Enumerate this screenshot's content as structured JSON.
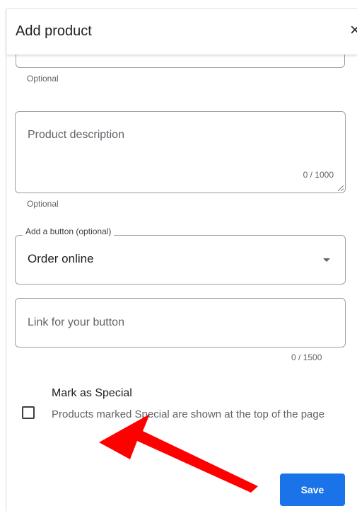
{
  "dialog": {
    "title": "Add product"
  },
  "fields": {
    "previous_helper": "Optional",
    "description": {
      "placeholder": "Product description",
      "counter": "0 / 1000",
      "helper": "Optional"
    },
    "button_select": {
      "label": "Add a button (optional)",
      "value": "Order online"
    },
    "link": {
      "placeholder": "Link for your button",
      "counter": "0 / 1500"
    }
  },
  "special": {
    "title": "Mark as Special",
    "description": "Products marked Special are shown at the top of the page",
    "checked": false
  },
  "footer": {
    "save_label": "Save"
  },
  "colors": {
    "accent": "#1a73e8",
    "annotation_arrow": "#ff0000"
  },
  "icons": {
    "close": "close-icon",
    "dropdown": "chevron-down-icon"
  }
}
